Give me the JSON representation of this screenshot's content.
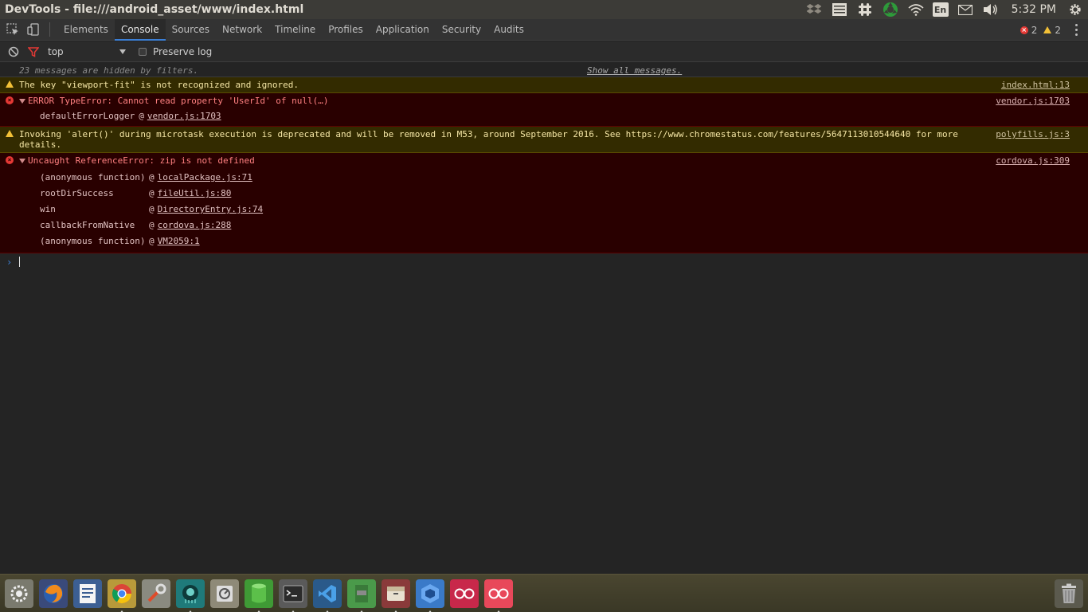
{
  "window": {
    "title": "DevTools - file:///android_asset/www/index.html"
  },
  "system_tray": {
    "language": "En",
    "clock": "5:32 PM",
    "icons": [
      "dropbox-icon",
      "list-icon",
      "slack-icon",
      "recycle-icon",
      "wifi-icon",
      "keyboard-lang-icon",
      "mail-icon",
      "volume-icon",
      "gear-icon"
    ]
  },
  "tabs": [
    {
      "label": "Elements"
    },
    {
      "label": "Console"
    },
    {
      "label": "Sources"
    },
    {
      "label": "Network"
    },
    {
      "label": "Timeline"
    },
    {
      "label": "Profiles"
    },
    {
      "label": "Application"
    },
    {
      "label": "Security"
    },
    {
      "label": "Audits"
    }
  ],
  "active_tab": "Console",
  "counts": {
    "errors": "2",
    "warnings": "2"
  },
  "filter_bar": {
    "context": "top",
    "preserve_log_label": "Preserve log",
    "preserve_log_checked": false
  },
  "console": {
    "hidden_text": "23 messages are hidden by filters.",
    "show_all": "Show all messages.",
    "messages": [
      {
        "level": "warning",
        "text": "The key \"viewport-fit\" is not recognized and ignored.",
        "source": "index.html:13"
      },
      {
        "level": "error",
        "text": "ERROR TypeError: Cannot read property 'UserId' of null(…)",
        "source": "vendor.js:1703",
        "stack": [
          {
            "fn": "defaultErrorLogger",
            "at": "@",
            "link": "vendor.js:1703"
          }
        ]
      },
      {
        "level": "warning",
        "text": "Invoking 'alert()' during microtask execution is deprecated and will be removed in M53, around September 2016. See https://www.chromestatus.com/features/5647113010544640 for more details.",
        "source": "polyfills.js:3"
      },
      {
        "level": "error",
        "text": "Uncaught ReferenceError: zip is not defined",
        "source": "cordova.js:309",
        "stack": [
          {
            "fn": "(anonymous function)",
            "at": "@",
            "link": "localPackage.js:71"
          },
          {
            "fn": "rootDirSuccess",
            "at": "@",
            "link": "fileUtil.js:80"
          },
          {
            "fn": "win",
            "at": "@",
            "link": "DirectoryEntry.js:74"
          },
          {
            "fn": "callbackFromNative",
            "at": "@",
            "link": "cordova.js:288"
          },
          {
            "fn": "(anonymous function)",
            "at": "@",
            "link": "VM2059:1"
          }
        ]
      }
    ]
  },
  "dock": {
    "apps": [
      {
        "name": "settings-app",
        "color": "#7a7a6e"
      },
      {
        "name": "firefox-app",
        "color": "#3a5c9c"
      },
      {
        "name": "text-editor-app",
        "color": "#3c5f93"
      },
      {
        "name": "chrome-app",
        "color": "#c8a33c"
      },
      {
        "name": "system-tools-app",
        "color": "#8a8a80"
      },
      {
        "name": "gitkraken-app",
        "color": "#2a8a8a"
      },
      {
        "name": "disk-usage-app",
        "color": "#9a9a8a"
      },
      {
        "name": "green-cylinder-app",
        "color": "#4aa83c"
      },
      {
        "name": "terminal-app",
        "color": "#4a4a4a"
      },
      {
        "name": "vscode-app",
        "color": "#2a5a8a"
      },
      {
        "name": "android-studio-app",
        "color": "#4a9a4a"
      },
      {
        "name": "archive-app",
        "color": "#8a3a3a"
      },
      {
        "name": "blue-app",
        "color": "#3a7ac8"
      },
      {
        "name": "flickr-app",
        "color": "#c8284a"
      },
      {
        "name": "flickr-alt-app",
        "color": "#e8485a"
      }
    ]
  }
}
